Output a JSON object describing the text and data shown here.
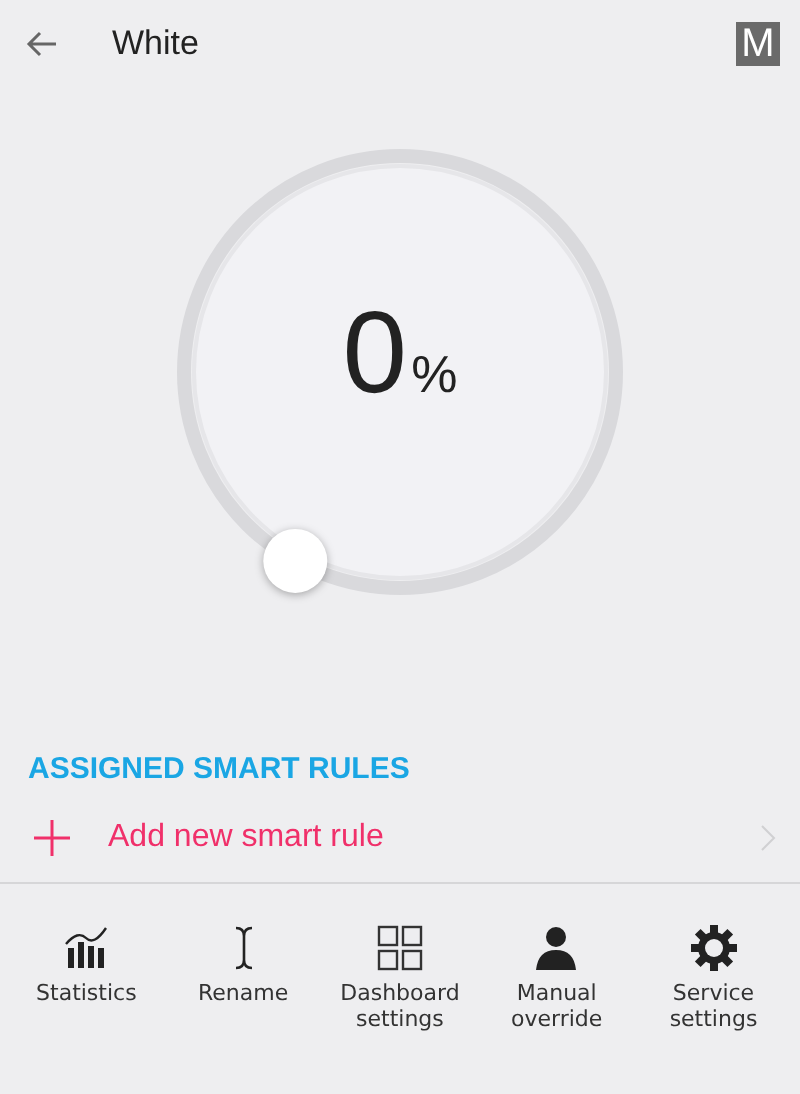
{
  "app_bar": {
    "title": "White",
    "badge": "M"
  },
  "dimmer": {
    "value": "0",
    "unit": "%"
  },
  "smart_rules": {
    "heading": "ASSIGNED SMART RULES",
    "add_label": "Add new smart rule"
  },
  "actions": [
    {
      "kind": "statistics",
      "label": "Statistics"
    },
    {
      "kind": "rename",
      "label": "Rename"
    },
    {
      "kind": "dashboard",
      "label": "Dashboard settings"
    },
    {
      "kind": "manual",
      "label": "Manual override"
    },
    {
      "kind": "service",
      "label": "Service settings"
    }
  ]
}
